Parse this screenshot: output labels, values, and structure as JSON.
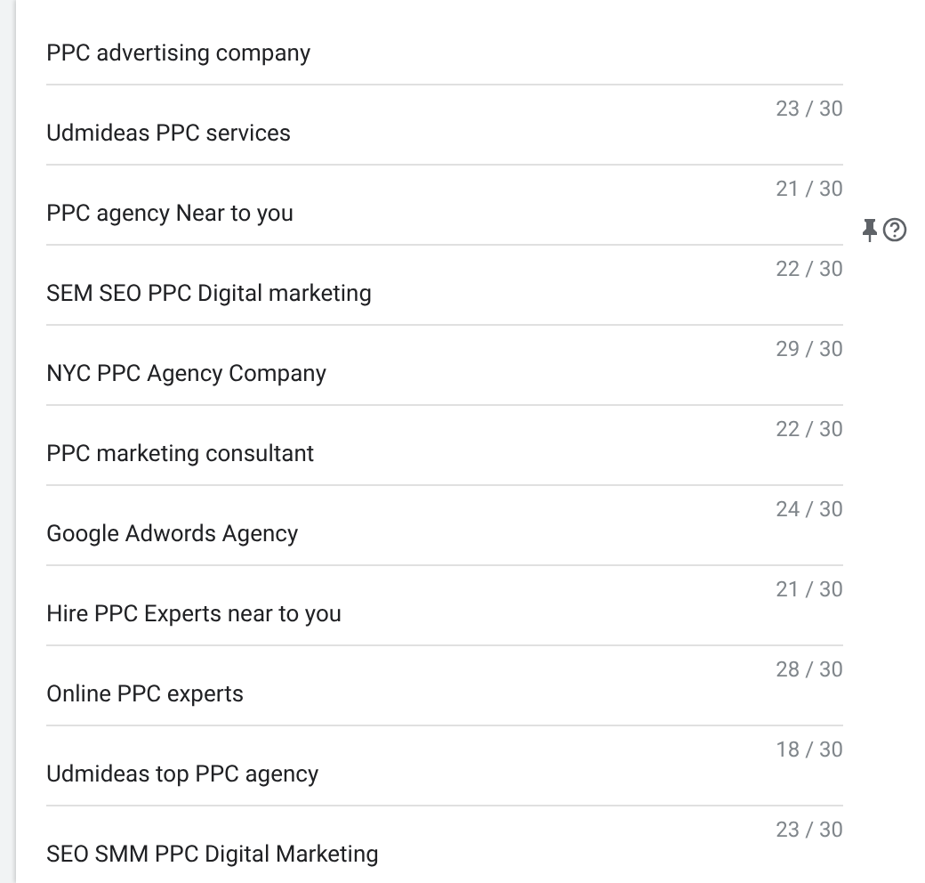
{
  "headlines": [
    {
      "text": "PPC advertising company",
      "pinned": false
    },
    {
      "count": "23 / 30",
      "text": "Udmideas PPC services",
      "pinned": false
    },
    {
      "count": "21 / 30",
      "text": "PPC agency Near to you",
      "pinned": true
    },
    {
      "count": "22 / 30",
      "text": "SEM SEO PPC Digital marketing",
      "pinned": false
    },
    {
      "count": "29 / 30",
      "text": "NYC PPC Agency Company",
      "pinned": false
    },
    {
      "count": "22 / 30",
      "text": "PPC marketing consultant",
      "pinned": false
    },
    {
      "count": "24 / 30",
      "text": "Google Adwords Agency",
      "pinned": false
    },
    {
      "count": "21 / 30",
      "text": "Hire PPC Experts near to you",
      "pinned": false
    },
    {
      "count": "28 / 30",
      "text": "Online PPC experts",
      "pinned": false
    },
    {
      "count": "18 / 30",
      "text": "Udmideas top PPC agency",
      "pinned": false
    },
    {
      "count": "23 / 30",
      "text": "SEO SMM PPC Digital Marketing",
      "pinned": false
    }
  ]
}
